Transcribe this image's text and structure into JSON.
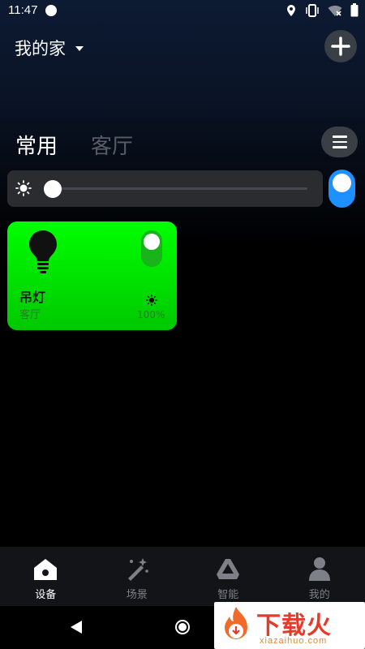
{
  "status_bar": {
    "time": "11:47",
    "icons": [
      "location-icon",
      "vibrate-icon",
      "wifi-off-icon",
      "battery-icon"
    ]
  },
  "header": {
    "home_name": "我的家",
    "add_icon": "plus-icon"
  },
  "tabs": [
    {
      "label": "常用",
      "active": true
    },
    {
      "label": "客厅",
      "active": false
    }
  ],
  "brightness": {
    "level": 0.0,
    "master_on": true
  },
  "devices": [
    {
      "name": "吊灯",
      "room": "客厅",
      "brightness": "100%",
      "on": true,
      "icon": "bulb-icon"
    }
  ],
  "bottom_nav": [
    {
      "label": "设备",
      "icon": "home-icon",
      "active": true
    },
    {
      "label": "场景",
      "icon": "magic-wand-icon",
      "active": false
    },
    {
      "label": "智能",
      "icon": "automation-icon",
      "active": false
    },
    {
      "label": "我的",
      "icon": "user-icon",
      "active": false
    }
  ],
  "watermark": {
    "title": "下载火",
    "subtitle": "xiazaihuo.com"
  },
  "colors": {
    "card_green": "#00ff00",
    "toggle_blue": "#1e90ff",
    "nav_background": "#121418"
  }
}
